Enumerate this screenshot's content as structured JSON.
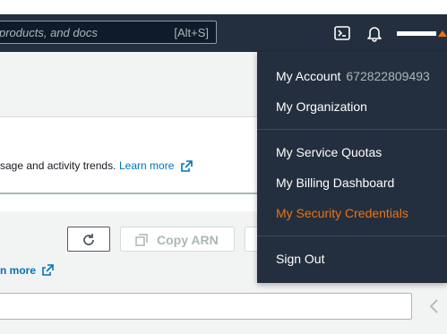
{
  "search": {
    "placeholder": "products, and docs",
    "shortcut": "[Alt+S]"
  },
  "icons": {
    "cloudshell": "terminal-icon",
    "notifications": "bell-icon",
    "account_caret": "caret-up-icon",
    "refresh": "refresh-icon",
    "copy": "copy-icon",
    "external": "external-link-icon",
    "pagination_prev": "chevron-left-icon"
  },
  "card": {
    "text": "sage and activity trends.",
    "learn_more": "Learn more"
  },
  "toolbar": {
    "copy_arn_label": "Copy ARN"
  },
  "section": {
    "learn_more": "n more"
  },
  "account_menu": {
    "my_account_label": "My Account",
    "account_id": "672822809493",
    "my_organization": "My Organization",
    "my_service_quotas": "My Service Quotas",
    "my_billing_dashboard": "My Billing Dashboard",
    "my_security_credentials": "My Security Credentials",
    "sign_out": "Sign Out"
  },
  "colors": {
    "nav_bg": "#232f3e",
    "accent_orange": "#ec7211",
    "link_blue": "#0073bb",
    "band_gray": "#f2f3f3"
  }
}
